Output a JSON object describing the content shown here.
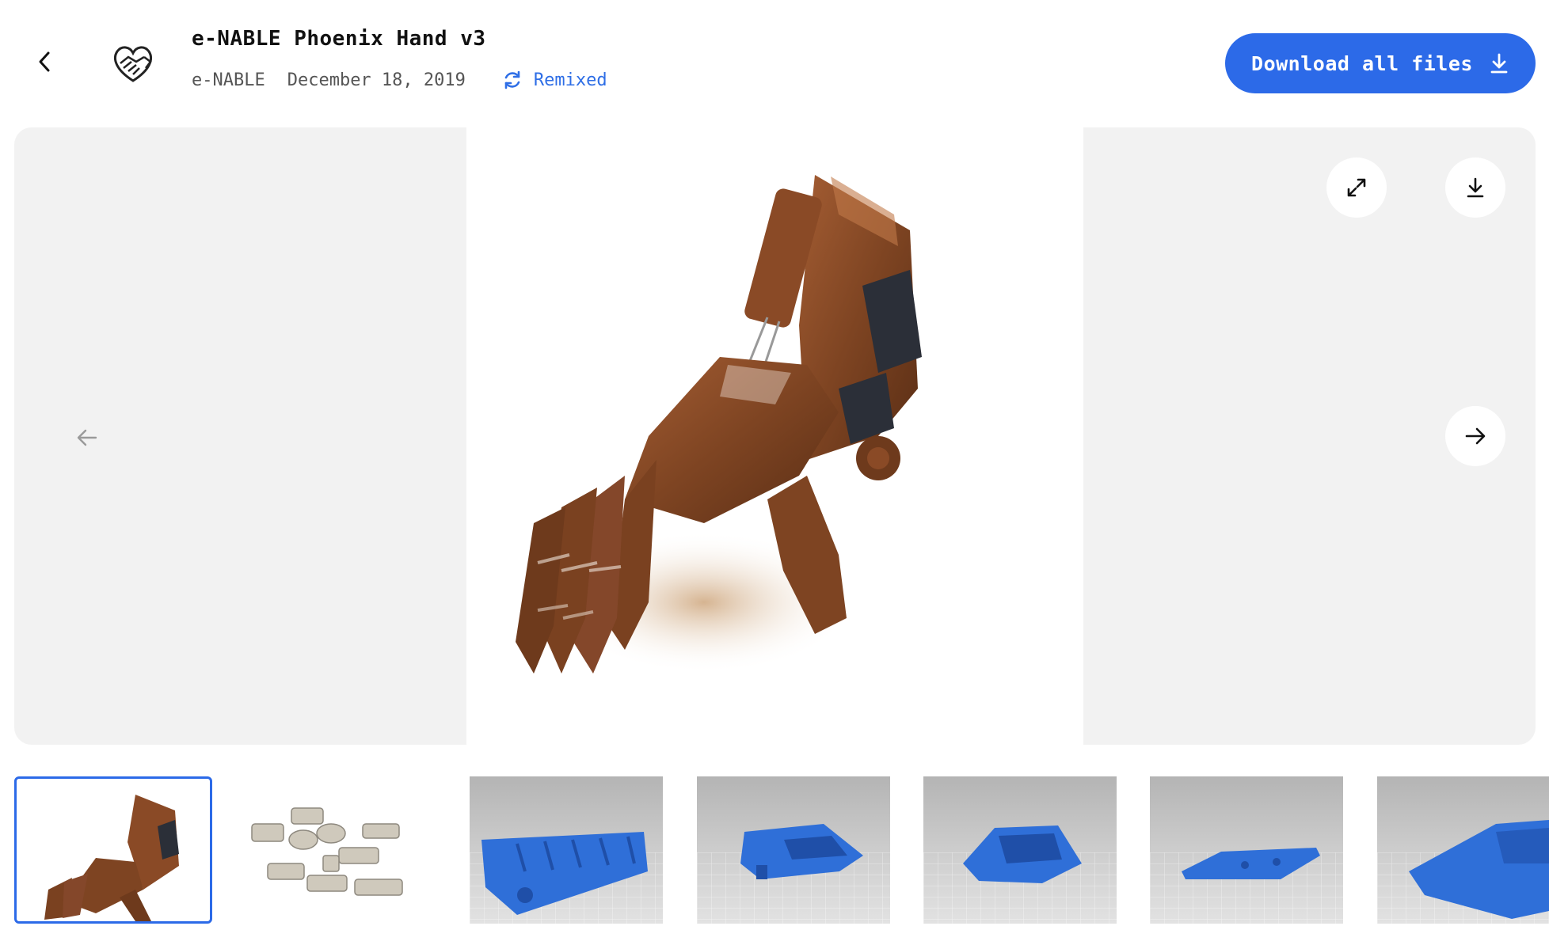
{
  "header": {
    "title": "e-NABLE Phoenix Hand v3",
    "author": "e-NABLE",
    "date": "December 18, 2019",
    "remix_label": "Remixed",
    "download_all_label": "Download all files"
  },
  "icons": {
    "back": "chevron-left-icon",
    "logo": "heart-hands-logo",
    "remix": "refresh-icon",
    "download": "download-icon",
    "fullscreen": "expand-icon",
    "prev": "arrow-left-icon",
    "next": "arrow-right-icon"
  },
  "viewer": {
    "image_subject": "brown 3D printed prosthetic hand",
    "selected_index": 0
  },
  "thumbnails": [
    {
      "subject": "brown prosthetic hand photo",
      "selected": true
    },
    {
      "subject": "grey hardware parts"
    },
    {
      "subject": "blue finger parts"
    },
    {
      "subject": "blue palm part"
    },
    {
      "subject": "blue palm part angled"
    },
    {
      "subject": "blue flat plate"
    },
    {
      "subject": "blue gauntlet part"
    }
  ],
  "colors": {
    "accent": "#2c6ae8",
    "hand_brown": "#8a4a26",
    "part_blue": "#2f6fd8",
    "viewer_bg": "#f2f2f2"
  }
}
